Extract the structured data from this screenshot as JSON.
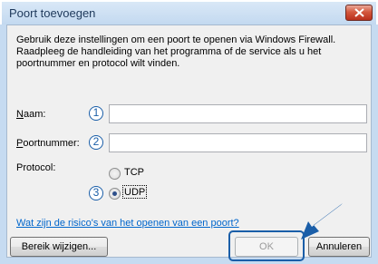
{
  "window": {
    "title": "Poort toevoegen"
  },
  "description": "Gebruik deze instellingen om een poort te openen via Windows Firewall. Raadpleeg de handleiding van het programma of de service als u het poortnummer en protocol wilt vinden.",
  "fields": {
    "name_label": "Naam:",
    "name_value": "",
    "port_label": "Poortnummer:",
    "port_value": ""
  },
  "protocol": {
    "label": "Protocol:",
    "options": [
      {
        "label": "TCP",
        "checked": false
      },
      {
        "label": "UDP",
        "checked": true
      }
    ]
  },
  "callouts": [
    "1",
    "2",
    "3"
  ],
  "link_text": "Wat zijn de risico's van het openen van een poort?",
  "buttons": {
    "change_scope": "Bereik wijzigen...",
    "ok": "OK",
    "cancel": "Annuleren"
  },
  "colors": {
    "callout_blue": "#1a5ea8",
    "link_blue": "#0066cc",
    "close_red": "#c13b22"
  }
}
